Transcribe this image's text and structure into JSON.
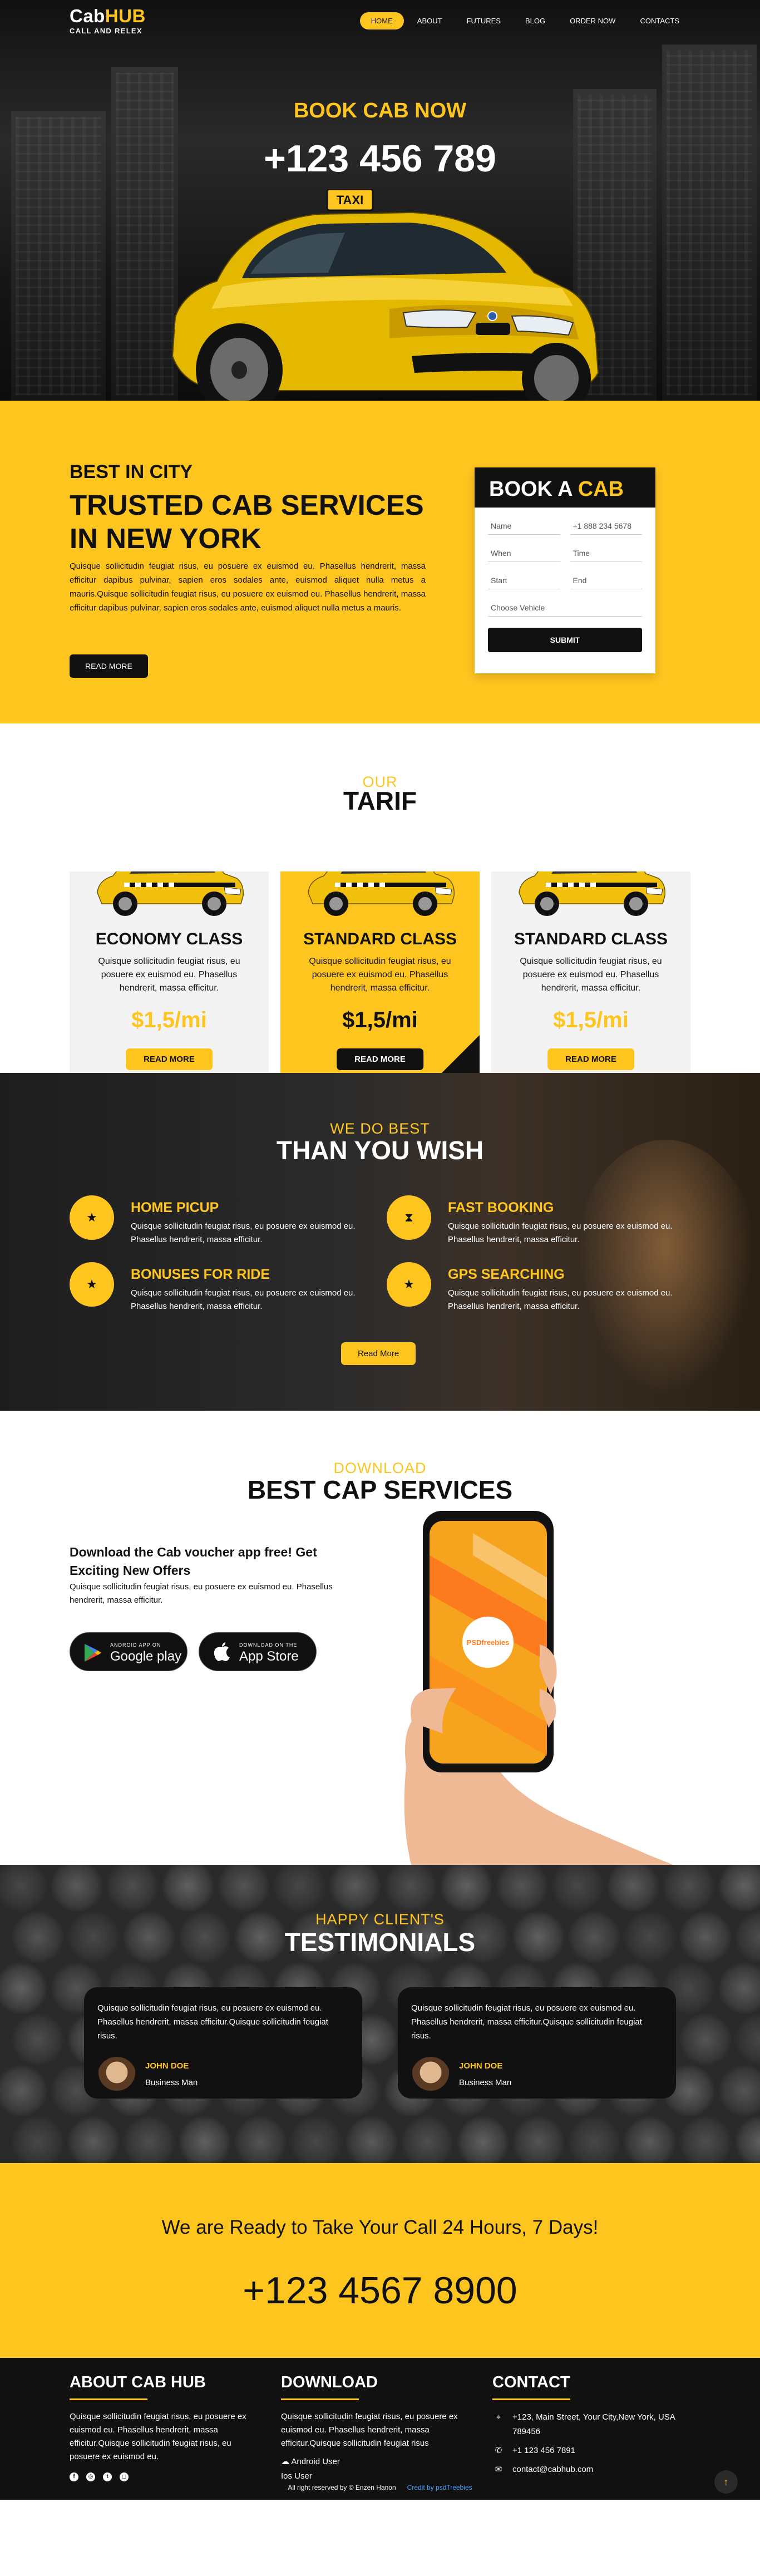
{
  "brand": {
    "name_a": "Cab",
    "name_b": "HUB",
    "tagline": "CALL AND RELEX",
    "accent": "#ffc51f",
    "dark": "#111111"
  },
  "nav": [
    {
      "label": "HOME",
      "active": true
    },
    {
      "label": "ABOUT"
    },
    {
      "label": "FUTURES"
    },
    {
      "label": "BLOG"
    },
    {
      "label": "ORDER NOW"
    },
    {
      "label": "CONTACTS"
    }
  ],
  "hero": {
    "title": "BOOK CAB NOW",
    "phone": "+123 456 789",
    "taxi_sign": "TAXI"
  },
  "intro": {
    "subtitle": "BEST IN CITY",
    "heading": "TRUSTED CAB SERVICES IN NEW YORK",
    "text": "Quisque sollicitudin feugiat risus, eu posuere ex euismod eu. Phasellus hendrerit, massa efficitur dapibus pulvinar, sapien eros sodales ante, euismod aliquet nulla metus a mauris.Quisque sollicitudin feugiat risus, eu posuere ex euismod eu. Phasellus hendrerit, massa efficitur dapibus pulvinar, sapien eros sodales ante, euismod aliquet nulla metus a mauris.",
    "button": "READ MORE"
  },
  "booking": {
    "title_a": "BOOK A ",
    "title_b": "CAB",
    "name_ph": "Name",
    "phone_ph": "+1 888 234 5678",
    "when_ph": "When",
    "time_ph": "Time",
    "start_ph": "Start",
    "end_ph": "End",
    "vehicle_ph": "Choose Vehicle",
    "submit": "SUBMIT"
  },
  "tarif": {
    "subtitle": "OUR",
    "heading": "TARIF",
    "cards": [
      {
        "title": "ECONOMY CLASS",
        "text": "Quisque sollicitudin feugiat risus, eu posuere ex euismod eu. Phasellus hendrerit, massa efficitur.",
        "price": "$1,5/mi",
        "button": "READ MORE"
      },
      {
        "title": "STANDARD CLASS",
        "text": "Quisque sollicitudin feugiat risus, eu posuere ex euismod eu. Phasellus hendrerit, massa efficitur.",
        "price": "$1,5/mi",
        "button": "READ MORE"
      },
      {
        "title": "STANDARD CLASS",
        "text": "Quisque sollicitudin feugiat risus, eu posuere ex euismod eu. Phasellus hendrerit, massa efficitur.",
        "price": "$1,5/mi",
        "button": "READ MORE"
      }
    ]
  },
  "best": {
    "subtitle": "WE DO BEST",
    "heading": "THAN YOU WISH",
    "items": [
      {
        "title": "HOME PICUP",
        "text": "Quisque sollicitudin feugiat risus, eu posuere ex euismod eu. Phasellus hendrerit, massa efficitur.",
        "icon": "star-icon"
      },
      {
        "title": "FAST BOOKING",
        "text": "Quisque sollicitudin feugiat risus, eu posuere ex euismod eu. Phasellus hendrerit, massa efficitur.",
        "icon": "hourglass-icon"
      },
      {
        "title": "BONUSES FOR RIDE",
        "text": "Quisque sollicitudin feugiat risus, eu posuere ex euismod eu. Phasellus hendrerit, massa efficitur.",
        "icon": "star-icon"
      },
      {
        "title": "GPS SEARCHING",
        "text": "Quisque sollicitudin feugiat risus, eu posuere ex euismod eu. Phasellus hendrerit, massa efficitur.",
        "icon": "star-icon"
      }
    ],
    "button": "Read More"
  },
  "app": {
    "subtitle": "DOWNLOAD",
    "heading": "BEST CAP SERVICES",
    "h3": "Download the Cab voucher app free! Get Exciting New Offers",
    "text": "Quisque sollicitudin feugiat risus, eu posuere ex euismod eu. Phasellus hendrerit, massa efficitur.",
    "google_small": "ANDROID APP ON",
    "google_name": "Google play",
    "apple_small": "DOWNLOAD ON THE",
    "apple_name": "App Store",
    "phone_brand": "PSDfreebies"
  },
  "testimonials": {
    "subtitle": "HAPPY CLIENT'S",
    "heading": "TESTIMONIALS",
    "items": [
      {
        "text": "Quisque sollicitudin feugiat risus, eu posuere ex euismod eu. Phasellus hendrerit, massa efficitur.Quisque sollicitudin feugiat risus.",
        "name": "JOHN DOE",
        "role": "Business Man"
      },
      {
        "text": "Quisque sollicitudin feugiat risus, eu posuere ex euismod eu. Phasellus hendrerit, massa efficitur.Quisque sollicitudin feugiat risus.",
        "name": "JOHN DOE",
        "role": "Business Man"
      }
    ]
  },
  "cta": {
    "line": "We are Ready to Take Your Call 24 Hours, 7 Days!",
    "phone": "+123 4567 8900"
  },
  "footer": {
    "about": {
      "title": "ABOUT CAB HUB",
      "text": "Quisque sollicitudin feugiat risus, eu posuere ex euismod eu. Phasellus hendrerit, massa efficitur.Quisque sollicitudin feugiat risus, eu posuere ex euismod eu."
    },
    "download": {
      "title": "DOWNLOAD",
      "text": "Quisque sollicitudin feugiat risus, eu posuere ex euismod eu. Phasellus hendrerit, massa efficitur.Quisque sollicitudin feugiat risus",
      "android": "Android User",
      "ios": "Ios User"
    },
    "contact": {
      "title": "CONTACT",
      "address": "+123, Main Street, Your City,New York, USA 789456",
      "phone": "+1 123 456 7891",
      "email": "contact@cabhub.com"
    },
    "copyright": "All right reserved by © Enzen Hanon",
    "credit": "Credit by psdTreebies"
  }
}
